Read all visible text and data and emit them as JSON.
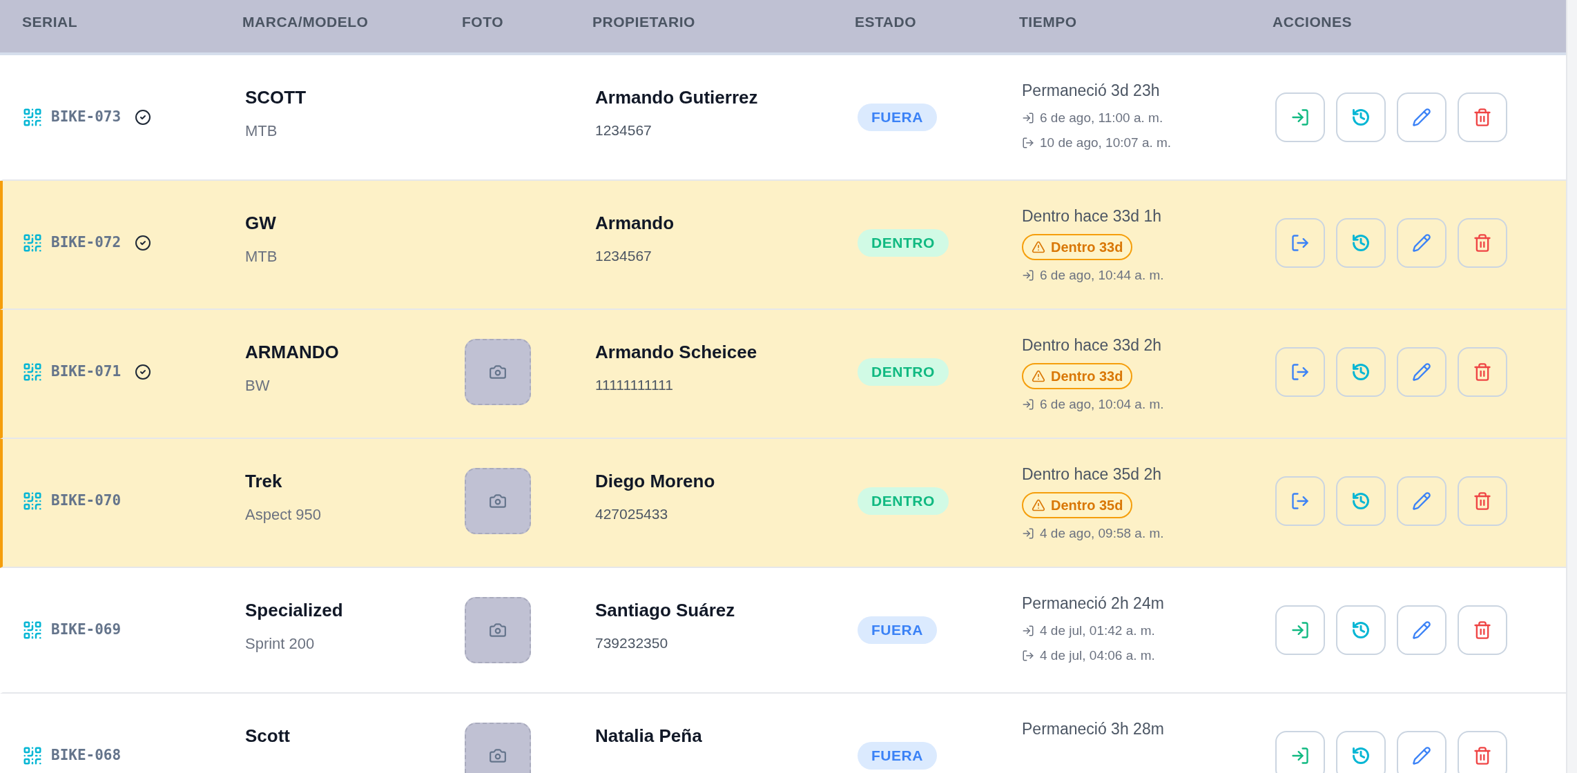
{
  "table": {
    "columns": [
      "SERIAL",
      "MARCA/MODELO",
      "FOTO",
      "PROPIETARIO",
      "ESTADO",
      "TIEMPO",
      "ACCIONES"
    ],
    "rows": [
      {
        "serial": "BIKE-073",
        "verified": true,
        "highlighted": false,
        "brand": "SCOTT",
        "model": "MTB",
        "photo": false,
        "owner": "Armando Gutierrez",
        "owner_id": "1234567",
        "status": {
          "kind": "out",
          "label": "FUERA"
        },
        "time": "Permaneció 3d 23h",
        "entries": [
          {
            "kind": "in",
            "text": "6 de ago, 11:00 a. m."
          },
          {
            "kind": "out",
            "text": "10 de ago, 10:07 a. m."
          }
        ]
      },
      {
        "serial": "BIKE-072",
        "verified": true,
        "highlighted": true,
        "brand": "GW",
        "model": "MTB",
        "photo": false,
        "owner": "Armando",
        "owner_id": "1234567",
        "status": {
          "kind": "in",
          "label": "DENTRO"
        },
        "time": "Dentro hace 33d 1h",
        "alert": "Dentro 33d",
        "entries": [
          {
            "kind": "in",
            "text": "6 de ago, 10:44 a. m."
          }
        ]
      },
      {
        "serial": "BIKE-071",
        "verified": true,
        "highlighted": true,
        "brand": "ARMANDO",
        "model": "BW",
        "photo": true,
        "owner": "Armando Scheicee",
        "owner_id": "11111111111",
        "status": {
          "kind": "in",
          "label": "DENTRO"
        },
        "time": "Dentro hace 33d 2h",
        "alert": "Dentro 33d",
        "entries": [
          {
            "kind": "in",
            "text": "6 de ago, 10:04 a. m."
          }
        ]
      },
      {
        "serial": "BIKE-070",
        "verified": false,
        "highlighted": true,
        "brand": "Trek",
        "model": "Aspect 950",
        "photo": true,
        "owner": "Diego Moreno",
        "owner_id": "427025433",
        "status": {
          "kind": "in",
          "label": "DENTRO"
        },
        "time": "Dentro hace 35d 2h",
        "alert": "Dentro 35d",
        "entries": [
          {
            "kind": "in",
            "text": "4 de ago, 09:58 a. m."
          }
        ]
      },
      {
        "serial": "BIKE-069",
        "verified": false,
        "highlighted": false,
        "brand": "Specialized",
        "model": "Sprint 200",
        "photo": true,
        "owner": "Santiago Suárez",
        "owner_id": "739232350",
        "status": {
          "kind": "out",
          "label": "FUERA"
        },
        "time": "Permaneció 2h 24m",
        "entries": [
          {
            "kind": "in",
            "text": "4 de jul, 01:42 a. m."
          },
          {
            "kind": "out",
            "text": "4 de jul, 04:06 a. m."
          }
        ]
      },
      {
        "serial": "BIKE-068",
        "verified": false,
        "highlighted": false,
        "brand": "Scott",
        "photo": true,
        "owner": "Natalia Peña",
        "status": {
          "kind": "out",
          "label": "FUERA"
        },
        "time": "Permaneció 3h 28m",
        "entries": []
      }
    ]
  }
}
